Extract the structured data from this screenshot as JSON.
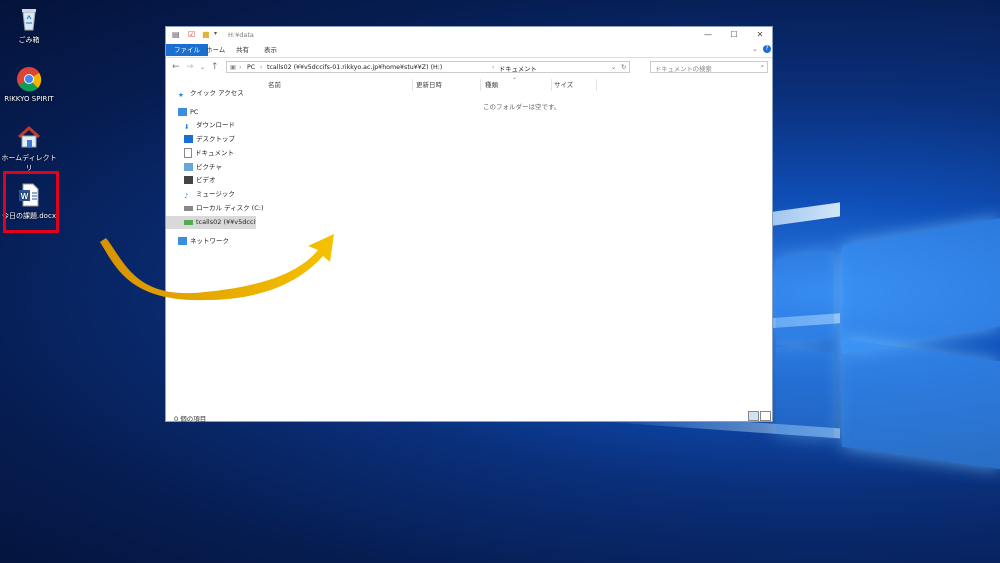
{
  "desktop": {
    "icons": [
      {
        "label": "ごみ箱",
        "icon": "recycle-bin-icon"
      },
      {
        "label": "RIKKYO SPIRIT",
        "icon": "chrome-icon"
      },
      {
        "label": "ホームディレクトリ",
        "icon": "home-folder-icon"
      },
      {
        "label": "今日の課題.docx",
        "icon": "word-document-icon"
      }
    ]
  },
  "explorer": {
    "title": "H:¥data",
    "ribbon_tabs": [
      "ファイル",
      "ホーム",
      "共有",
      "表示"
    ],
    "address": {
      "crumbs": [
        "PC",
        "tcalls02 (¥¥v5dccifs-01.rikkyo.ac.jp¥home¥stu¥¥Z) (H:)",
        "ドキュメント"
      ]
    },
    "search_placeholder": "ドキュメントの検索",
    "nav": [
      {
        "label": "クイック アクセス",
        "icon": "star-icon"
      },
      {
        "label": "PC",
        "icon": "computer-icon"
      },
      {
        "label": "ダウンロード",
        "icon": "download-icon"
      },
      {
        "label": "デスクトップ",
        "icon": "desktop-icon"
      },
      {
        "label": "ドキュメント",
        "icon": "document-icon"
      },
      {
        "label": "ピクチャ",
        "icon": "picture-icon"
      },
      {
        "label": "ビデオ",
        "icon": "video-icon"
      },
      {
        "label": "ミュージック",
        "icon": "music-icon"
      },
      {
        "label": "ローカル ディスク (C:)",
        "icon": "disk-icon"
      },
      {
        "label": "tcalls02 (¥¥v5dccifs-",
        "icon": "network-drive-icon"
      },
      {
        "label": "ネットワーク",
        "icon": "network-icon"
      }
    ],
    "columns": [
      "名前",
      "更新日時",
      "種類",
      "サイズ"
    ],
    "empty_message": "このフォルダーは空です。",
    "status": "0 個の項目"
  },
  "colors": {
    "accent": "#1a6fd1",
    "arrow": "#e8a400",
    "highlight": "#e3001b"
  }
}
